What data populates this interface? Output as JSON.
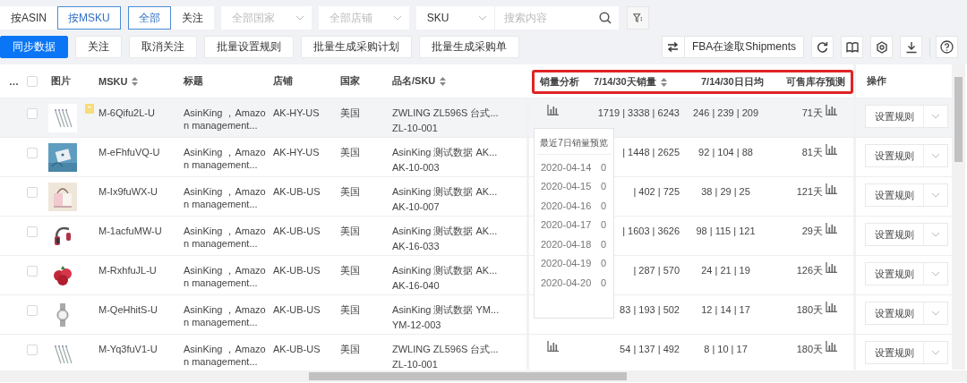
{
  "filter_bar": {
    "view_toggle": [
      {
        "label": "按ASIN",
        "selected": false
      },
      {
        "label": "按MSKU",
        "selected": true
      }
    ],
    "follow_toggle": [
      {
        "label": "全部",
        "selected": true
      },
      {
        "label": "关注",
        "selected": false
      }
    ],
    "selects": [
      {
        "placeholder": "全部国家"
      },
      {
        "placeholder": "全部店铺"
      },
      {
        "value": "SKU"
      }
    ],
    "search": {
      "placeholder": "搜索内容"
    }
  },
  "action_bar": {
    "buttons": [
      {
        "label": "同步数据",
        "kind": "primary"
      },
      {
        "label": "关注",
        "kind": "default"
      },
      {
        "label": "取消关注",
        "kind": "default"
      },
      {
        "label": "批量设置规则",
        "kind": "default"
      },
      {
        "label": "批量生成采购计划",
        "kind": "default"
      },
      {
        "label": "批量生成采购单",
        "kind": "default"
      }
    ],
    "fba_button": "FBA在途取Shipments"
  },
  "table": {
    "columns": [
      {
        "label": "…",
        "kind": "text",
        "sortable": false,
        "highlighted": false
      },
      {
        "kind": "checkbox",
        "checked": false,
        "highlighted": false
      },
      {
        "label": "图片",
        "kind": "text",
        "sortable": false,
        "highlighted": false
      },
      {
        "label": "MSKU",
        "kind": "text",
        "sortable": true,
        "highlighted": false
      },
      {
        "label": "标题",
        "kind": "text",
        "sortable": false,
        "highlighted": false
      },
      {
        "label": "店铺",
        "kind": "text",
        "sortable": false,
        "highlighted": false
      },
      {
        "label": "国家",
        "kind": "text",
        "sortable": false,
        "highlighted": false
      },
      {
        "label": "品名/SKU",
        "kind": "text",
        "sortable": true,
        "highlighted": false
      },
      {
        "label": "销量分析",
        "kind": "text",
        "sortable": false,
        "highlighted": true
      },
      {
        "label": "7/14/30天销量",
        "kind": "text",
        "sortable": true,
        "highlighted": true
      },
      {
        "label": "7/14/30日日均",
        "kind": "text",
        "sortable": false,
        "highlighted": true
      },
      {
        "label": "可售库存预测",
        "kind": "text",
        "sortable": false,
        "highlighted": true
      },
      {
        "label": "操作",
        "kind": "text",
        "sortable": false,
        "highlighted": false
      }
    ],
    "rows": [
      {
        "checked": false,
        "hovered": true,
        "followed": true,
        "msku": "M-6Qifu2L-U",
        "title": "AsinKing ，Amazon management...",
        "store": "AK-HY-US",
        "country": "美国",
        "name": "ZWLING ZL596S 台式...",
        "sku": "ZL-10-001",
        "sales": "1719 | 3338 | 6243",
        "daily_avg": "246 | 239 | 209",
        "stock_forecast": "71天",
        "action": "设置规则"
      },
      {
        "checked": false,
        "hovered": false,
        "followed": false,
        "msku": "M-eFhfuVQ-U",
        "title": "AsinKing ，Amazon management...",
        "store": "AK-HY-US",
        "country": "美国",
        "name": "AsinKing 测试数据 AK...",
        "sku": "AK-10-003",
        "sales": "| 1448 | 2625",
        "daily_avg": "92 | 104 | 88",
        "stock_forecast": "81天",
        "action": "设置规则"
      },
      {
        "checked": false,
        "hovered": false,
        "followed": false,
        "msku": "M-Ix9fuWX-U",
        "title": "AsinKing ，Amazon management...",
        "store": "AK-UB-US",
        "country": "美国",
        "name": "AsinKing 测试数据 AK...",
        "sku": "AK-10-007",
        "sales": "| 402 | 725",
        "daily_avg": "38 | 29 | 25",
        "stock_forecast": "121天",
        "action": "设置规则"
      },
      {
        "checked": false,
        "hovered": false,
        "followed": false,
        "msku": "M-1acfuMW-U",
        "title": "AsinKing ，Amazon management...",
        "store": "AK-UB-US",
        "country": "美国",
        "name": "AsinKing 测试数据 AK...",
        "sku": "AK-16-033",
        "sales": "| 1603 | 3626",
        "daily_avg": "98 | 115 | 121",
        "stock_forecast": "29天",
        "action": "设置规则"
      },
      {
        "checked": false,
        "hovered": false,
        "followed": false,
        "msku": "M-RxhfuJL-U",
        "title": "AsinKing ，Amazon management...",
        "store": "AK-UB-US",
        "country": "美国",
        "name": "AsinKing 测试数据 AK...",
        "sku": "AK-16-040",
        "sales": "| 287 | 570",
        "daily_avg": "24 | 21 | 19",
        "stock_forecast": "126天",
        "action": "设置规则"
      },
      {
        "checked": false,
        "hovered": false,
        "followed": false,
        "msku": "M-QeHhitS-U",
        "title": "AsinKing ，Amazon management...",
        "store": "AK-UB-US",
        "country": "美国",
        "name": "AsinKing 测试数据 YM...",
        "sku": "YM-12-003",
        "sales": "83 | 193 | 502",
        "daily_avg": "12 | 14 | 17",
        "stock_forecast": "180天",
        "action": "设置规则"
      },
      {
        "checked": false,
        "hovered": false,
        "followed": false,
        "msku": "M-Yq3fuV1-U",
        "title": "AsinKing ，Amazon management...",
        "store": "AK-UB-US",
        "country": "美国",
        "name": "ZWLING ZL596S 台式...",
        "sku": "ZL-10-001",
        "sales": "54 | 137 | 492",
        "daily_avg": "8 | 10 | 17",
        "stock_forecast": "180天",
        "action": "设置规则"
      }
    ],
    "sales_popover": {
      "title": "最近7日销量预览",
      "entries": [
        {
          "date": "2020-04-14",
          "value": "0"
        },
        {
          "date": "2020-04-15",
          "value": "0"
        },
        {
          "date": "2020-04-16",
          "value": "0"
        },
        {
          "date": "2020-04-17",
          "value": "0"
        },
        {
          "date": "2020-04-18",
          "value": "0"
        },
        {
          "date": "2020-04-19",
          "value": "0"
        },
        {
          "date": "2020-04-20",
          "value": "0"
        }
      ]
    }
  }
}
